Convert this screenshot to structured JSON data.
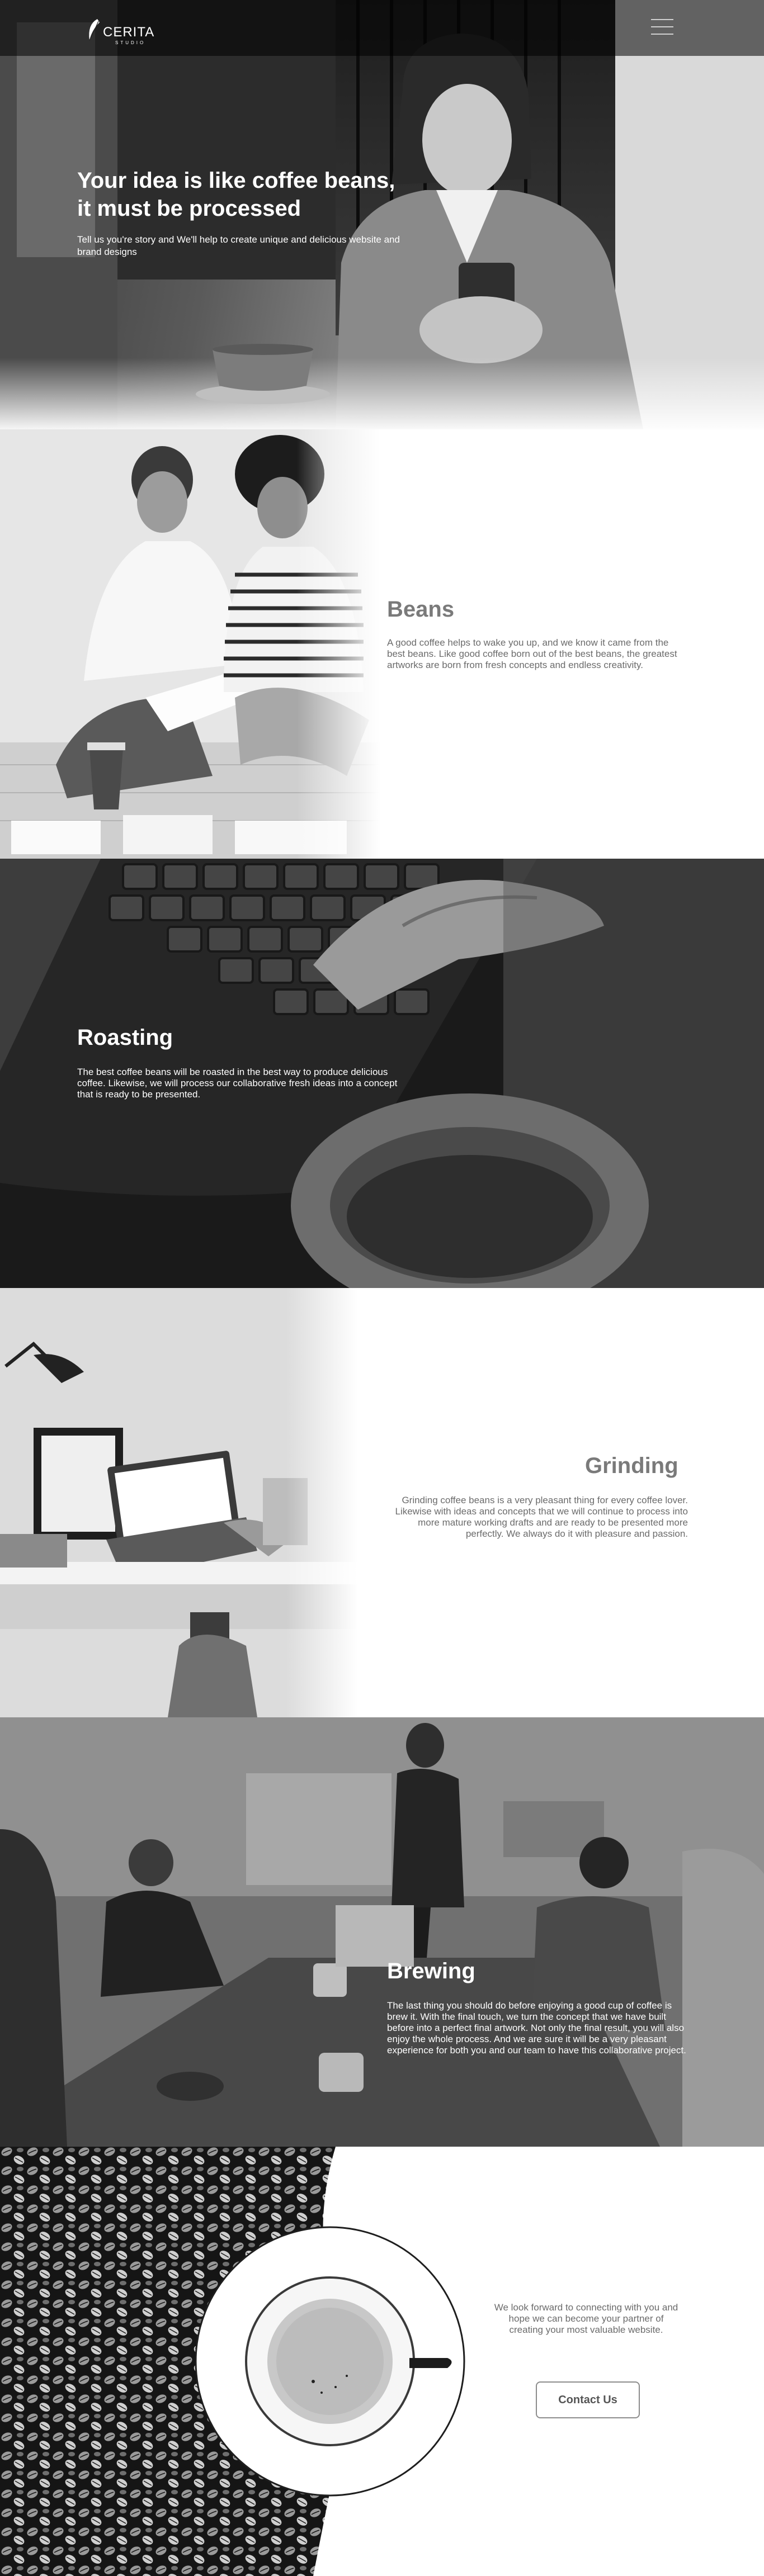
{
  "brand": {
    "name": "CERITA",
    "tagline": "STUDIO"
  },
  "nav": {
    "menu_icon": "hamburger-menu-icon"
  },
  "hero": {
    "title_line1": "Your idea is like coffee beans,",
    "title_line2": "it must be processed",
    "subtitle": "Tell us you're story and We'll help to create unique and delicious website and brand designs"
  },
  "beans": {
    "title": "Beans",
    "body": "A good coffee helps to wake you up, and we know it came from the best beans. Like good coffee born out of the best beans, the greatest artworks are born from fresh concepts and endless creativity."
  },
  "roasting": {
    "title": "Roasting",
    "body": "The best coffee beans will be roasted in the best way to produce delicious coffee. Likewise, we will process our collaborative fresh ideas into a concept that is ready to be presented."
  },
  "grinding": {
    "title": "Grinding",
    "body": "Grinding coffee beans is a very  pleasant thing for every coffee lover. Likewise with ideas and concepts that we will continue to process into more mature working drafts and are ready to be presented more perfectly. We always do it with pleasure and passion."
  },
  "brewing": {
    "title": "Brewing",
    "body": "The last thing you should do before enjoying a good cup of coffee is brew it. With the final touch, we turn the concept that we have built before into a perfect final artwork. Not only the final result, you will also enjoy the whole process. And we are sure it will be a very pleasant experience for both you and our team to have this collaborative project."
  },
  "contact": {
    "body": "We look forward to connecting with you and hope we can become your partner of creating your most valuable website.",
    "button_label": "Contact Us"
  },
  "colors": {
    "text_gray": "#6b6b6b",
    "title_gray": "#7a7a7a",
    "white": "#ffffff",
    "button_border": "#8c8c8c"
  }
}
